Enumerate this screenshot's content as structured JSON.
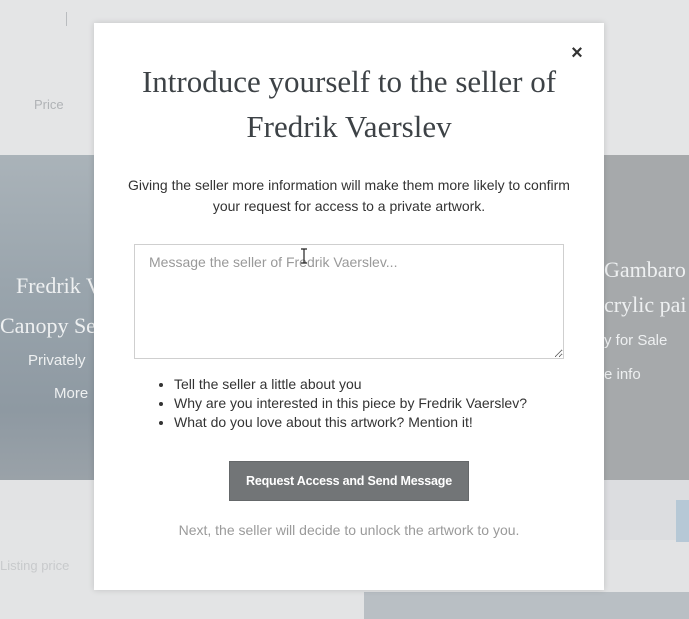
{
  "background": {
    "filter_label": "Price",
    "left_card": {
      "artist": "Fredrik V",
      "title": "Canopy Se",
      "status": "Privately",
      "link": "More"
    },
    "right_card": {
      "artist": "Gambaro",
      "title": "crylic pai",
      "status": "y for Sale",
      "link": "e info"
    },
    "listing_label": "Listing price"
  },
  "modal": {
    "close_label": "×",
    "title": "Introduce yourself to the seller of Fredrik Vaerslev",
    "subtitle": "Giving the seller more information will make them more likely to confirm your request for access to a private artwork.",
    "message_placeholder": "Message the seller of Fredrik Vaerslev...",
    "message_value": "",
    "tips": [
      "Tell the seller a little about you",
      "Why are you interested in this piece by Fredrik Vaerslev?",
      "What do you love about this artwork? Mention it!"
    ],
    "submit_label": "Request Access and Send Message",
    "footnote": "Next, the seller will decide to unlock the artwork to you."
  }
}
